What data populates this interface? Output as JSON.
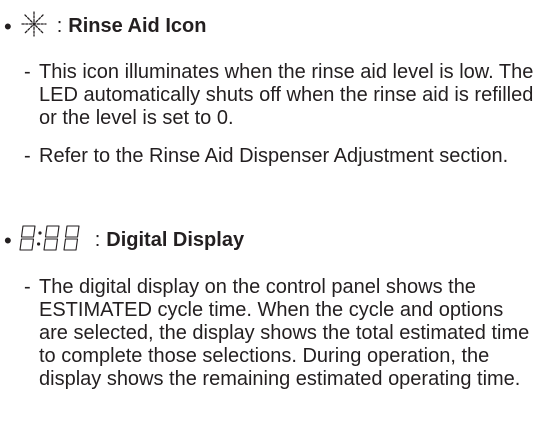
{
  "sections": [
    {
      "bullet": "•",
      "icon": "rinse-aid-sparkle-icon",
      "separator": ":",
      "title": "Rinse Aid Icon",
      "items": [
        {
          "dash": "-",
          "text": "This icon illuminates when the rinse aid level is low. The LED automatically shuts off when the rinse aid is refilled or the level is set to 0."
        },
        {
          "dash": "-",
          "text": "Refer to the Rinse Aid Dispenser Adjustment section."
        }
      ]
    },
    {
      "bullet": "•",
      "icon": "digital-display-8-88-icon",
      "separator": ":",
      "title": "Digital Display",
      "items": [
        {
          "dash": "-",
          "text": "The digital display on the control panel shows the ESTIMATED cycle time. When the cycle and options are selected, the display shows the total estimated time to complete those selections. During operation, the display shows the remaining estimated operating time."
        }
      ]
    }
  ]
}
